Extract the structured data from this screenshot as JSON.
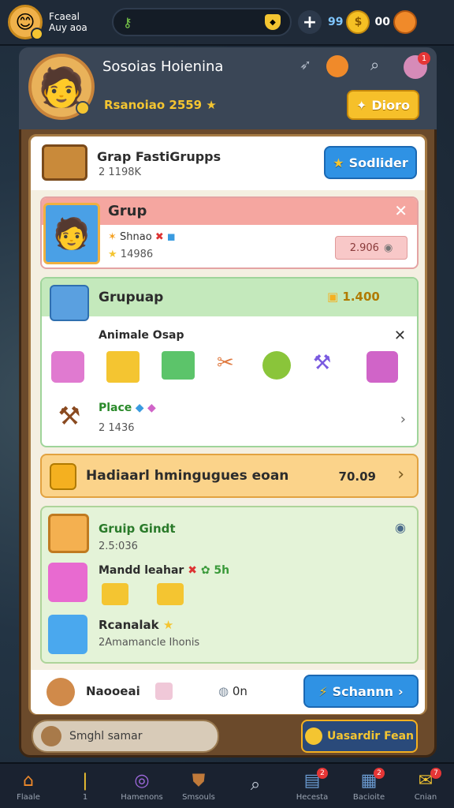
{
  "topbar": {
    "user_line1": "Fcaeal",
    "user_line2": "Auy aoa",
    "gems": "99",
    "coins": "00",
    "plus": "+"
  },
  "profile": {
    "name": "Sosoias Hoienina",
    "level": "Rsanoiao 2559",
    "button_label": "Dioro",
    "notif_count": "1"
  },
  "panel": {
    "top_row": {
      "title": "Grap FastiGrupps",
      "sub": "2 1198K",
      "button": "Sodlider"
    },
    "grup_card": {
      "title": "Grup",
      "line": "Shnao",
      "sub": "14986",
      "value": "2.906"
    },
    "grupuap_card": {
      "title": "Grupuap",
      "value": "1.400",
      "inner_title": "Animale Osap",
      "place_label": "Place",
      "place_sub": "2 1436"
    },
    "banner": {
      "text": "Hadiaarl hmingugues eoan",
      "value": "70.09"
    },
    "green_card": {
      "title": "Gruip Gindt",
      "sub": "2.5:036",
      "line2": "Mandd leahar",
      "line2_tail": "5h",
      "line3": "Rcanalak",
      "line3_sub": "2Amamancle Ihonis"
    },
    "footer_row": {
      "label": "Naooeai",
      "value": "0n",
      "button": "Schannn"
    }
  },
  "bottom_strip": {
    "left_label": "Smghl samar",
    "right_button": "Uasardir Fean"
  },
  "nav": [
    {
      "label": "Flaale",
      "icon": "home-icon"
    },
    {
      "label": "1",
      "icon": "bar-icon"
    },
    {
      "label": "Hamenons",
      "icon": "compass-icon"
    },
    {
      "label": "Smsouls",
      "icon": "shield-icon"
    },
    {
      "label": "",
      "icon": "search-icon"
    },
    {
      "label": "Hecesta",
      "icon": "shop-icon",
      "badge": "2"
    },
    {
      "label": "Bacioite",
      "icon": "box-icon",
      "badge": "2"
    },
    {
      "label": "Cnian",
      "icon": "mail-icon",
      "badge": "7"
    }
  ]
}
